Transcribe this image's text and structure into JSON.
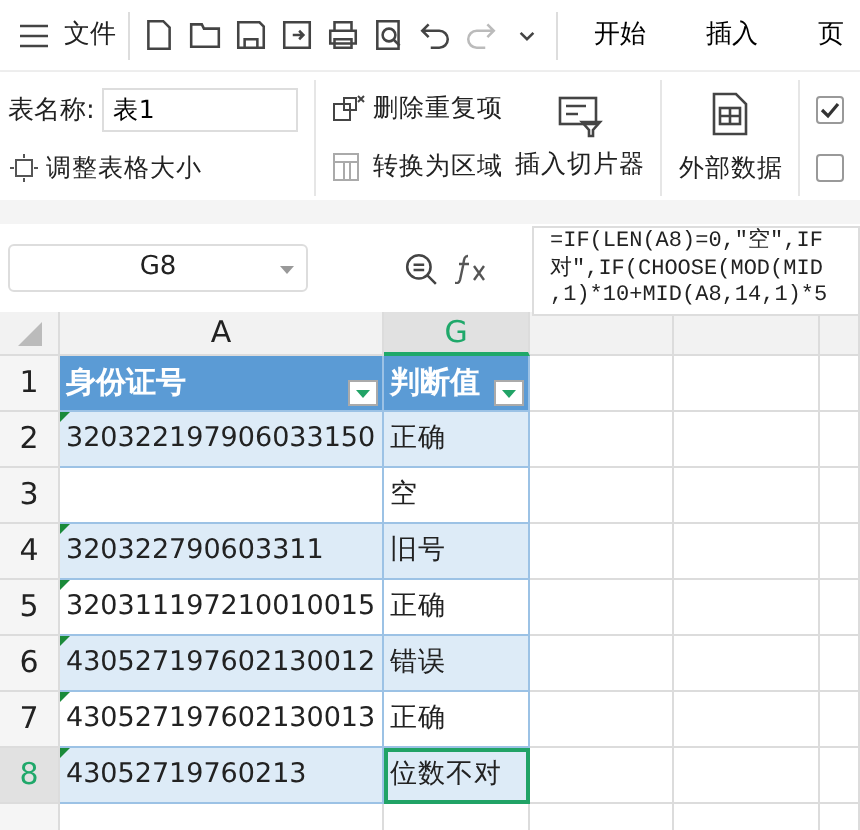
{
  "menu": {
    "label": "文件"
  },
  "tabs": [
    {
      "label": "开始",
      "selected": false
    },
    {
      "label": "插入",
      "selected": false
    },
    {
      "label": "页",
      "selected": false
    }
  ],
  "ribbon": {
    "table_name_label": "表名称:",
    "table_name_value": "表1",
    "resize": "调整表格大小",
    "remove_duplicates": "删除重复项",
    "convert_range": "转换为区域",
    "insert_slicer": "插入切片器",
    "external_data": "外部数据",
    "checkboxes": [
      {
        "checked": true
      },
      {
        "checked": false
      }
    ]
  },
  "name_box": "G8",
  "formula_lines": [
    "=IF(LEN(A8)=0,″空″,IF",
    "对″,IF(CHOOSE(MOD(MID",
    ",1)*10+MID(A8,14,1)*5"
  ],
  "columns": [
    {
      "label": "A",
      "selected": false
    },
    {
      "label": "G",
      "selected": true
    }
  ],
  "header_row": {
    "num": "1",
    "cells": [
      "身份证号",
      "判断值"
    ]
  },
  "rows": [
    {
      "num": "2",
      "id": "320322197906033150",
      "result": "正确",
      "flag": true,
      "selected": false
    },
    {
      "num": "3",
      "id": "",
      "result": "空",
      "flag": false,
      "selected": false
    },
    {
      "num": "4",
      "id": "320322790603311",
      "result": "旧号",
      "flag": true,
      "selected": false
    },
    {
      "num": "5",
      "id": "320311197210010015",
      "result": "正确",
      "flag": true,
      "selected": false
    },
    {
      "num": "6",
      "id": "430527197602130012",
      "result": "错误",
      "flag": true,
      "selected": false
    },
    {
      "num": "7",
      "id": "430527197602130013",
      "result": "正确",
      "flag": true,
      "selected": false
    },
    {
      "num": "8",
      "id": "43052719760213",
      "result": "位数不对",
      "flag": true,
      "selected": true
    }
  ]
}
